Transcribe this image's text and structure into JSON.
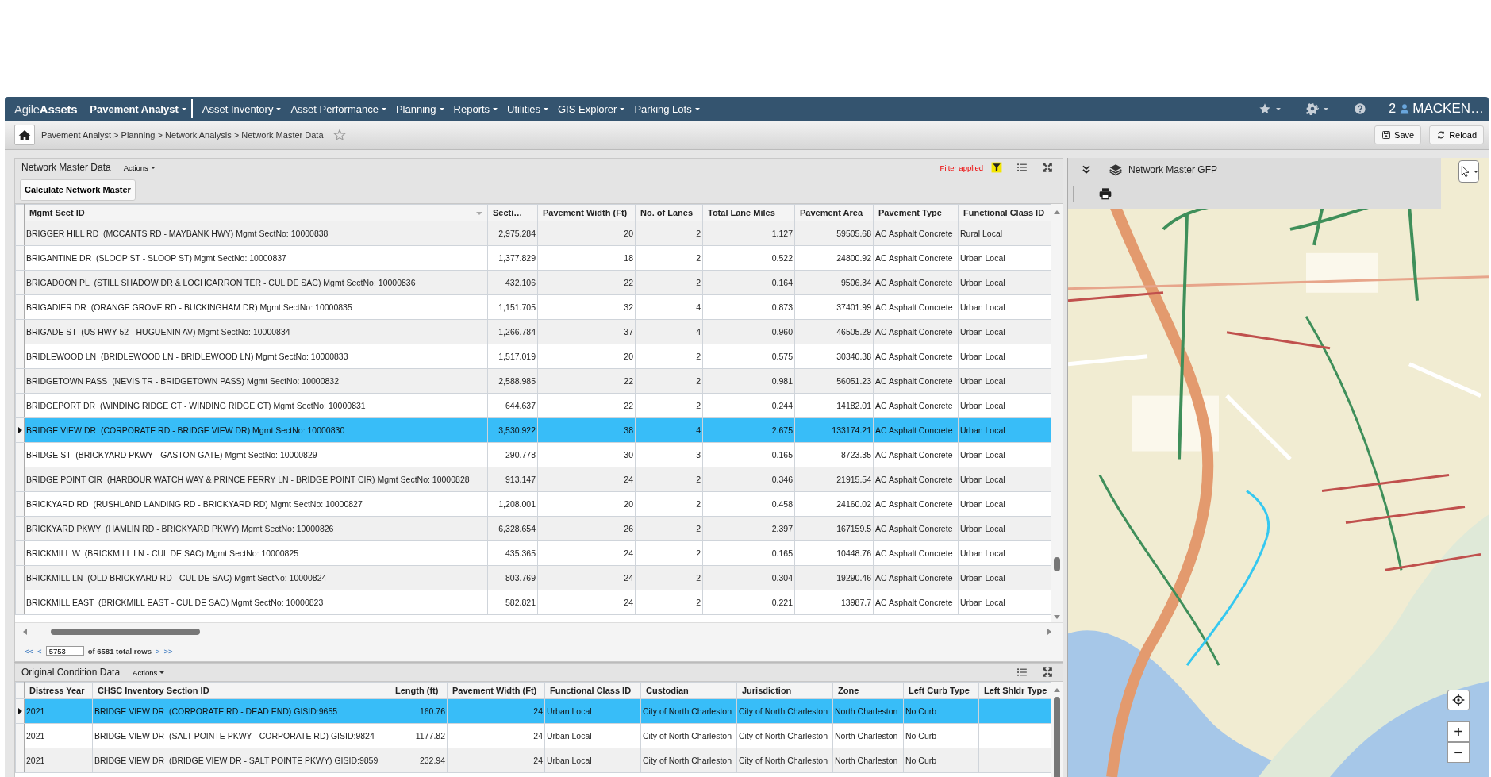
{
  "nav": {
    "logo": "Agile**Assets**",
    "menus": [
      {
        "label": "Pavement Analyst",
        "kind": "app"
      },
      {
        "label": "Asset Inventory",
        "kind": "menu"
      },
      {
        "label": "Asset Performance",
        "kind": "menu"
      },
      {
        "label": "Planning",
        "kind": "menu"
      },
      {
        "label": "Reports",
        "kind": "menu"
      },
      {
        "label": "Utilities",
        "kind": "menu"
      },
      {
        "label": "GIS Explorer",
        "kind": "menu"
      },
      {
        "label": "Parking Lots",
        "kind": "menu"
      }
    ],
    "notification_count": "2",
    "user": "MACKEN…"
  },
  "breadcrumb": {
    "path": "Pavement Analyst > Planning > Network Analysis > Network Master Data",
    "buttons": [
      "Save",
      "Reload"
    ]
  },
  "network_grid": {
    "title": "Network Master Data",
    "actions": "Actions",
    "filter_label": "Filter applied",
    "button": "Calculate Network Master",
    "columns": [
      {
        "label": "Mgmt Sect ID",
        "kind": "text"
      },
      {
        "label": "Secti…",
        "kind": "number"
      },
      {
        "label": "Pavement Width (Ft)",
        "kind": "number"
      },
      {
        "label": "No. of Lanes",
        "kind": "number"
      },
      {
        "label": "Total Lane Miles",
        "kind": "number"
      },
      {
        "label": "Pavement Area",
        "kind": "number"
      },
      {
        "label": "Pavement Type",
        "kind": "text"
      },
      {
        "label": "Functional Class ID",
        "kind": "text"
      }
    ],
    "rows": [
      {
        "selected": false,
        "cells": [
          "BRIGGER HILL RD  (MCCANTS RD - MAYBANK HWY) Mgmt SectNo: 10000838",
          "2,975.284",
          "20",
          "2",
          "1.127",
          "59505.68",
          "AC Asphalt Concrete",
          "Rural Local"
        ]
      },
      {
        "selected": false,
        "cells": [
          "BRIGANTINE DR  (SLOOP ST - SLOOP ST) Mgmt SectNo: 10000837",
          "1,377.829",
          "18",
          "2",
          "0.522",
          "24800.92",
          "AC Asphalt Concrete",
          "Urban Local"
        ]
      },
      {
        "selected": false,
        "cells": [
          "BRIGADOON PL  (STILL SHADOW DR & LOCHCARRON TER - CUL DE SAC) Mgmt SectNo: 10000836",
          "432.106",
          "22",
          "2",
          "0.164",
          "9506.34",
          "AC Asphalt Concrete",
          "Urban Local"
        ]
      },
      {
        "selected": false,
        "cells": [
          "BRIGADIER DR  (ORANGE GROVE RD - BUCKINGHAM DR) Mgmt SectNo: 10000835",
          "1,151.705",
          "32",
          "4",
          "0.873",
          "37401.99",
          "AC Asphalt Concrete",
          "Urban Local"
        ]
      },
      {
        "selected": false,
        "cells": [
          "BRIGADE ST  (US HWY 52 - HUGUENIN AV) Mgmt SectNo: 10000834",
          "1,266.784",
          "37",
          "4",
          "0.960",
          "46505.29",
          "AC Asphalt Concrete",
          "Urban Local"
        ]
      },
      {
        "selected": false,
        "cells": [
          "BRIDLEWOOD LN  (BRIDLEWOOD LN - BRIDLEWOOD LN) Mgmt SectNo: 10000833",
          "1,517.019",
          "20",
          "2",
          "0.575",
          "30340.38",
          "AC Asphalt Concrete",
          "Urban Local"
        ]
      },
      {
        "selected": false,
        "cells": [
          "BRIDGETOWN PASS  (NEVIS TR - BRIDGETOWN PASS) Mgmt SectNo: 10000832",
          "2,588.985",
          "22",
          "2",
          "0.981",
          "56051.23",
          "AC Asphalt Concrete",
          "Urban Local"
        ]
      },
      {
        "selected": false,
        "cells": [
          "BRIDGEPORT DR  (WINDING RIDGE CT - WINDING RIDGE CT) Mgmt SectNo: 10000831",
          "644.637",
          "22",
          "2",
          "0.244",
          "14182.01",
          "AC Asphalt Concrete",
          "Urban Local"
        ]
      },
      {
        "selected": true,
        "cells": [
          "BRIDGE VIEW DR  (CORPORATE RD - BRIDGE VIEW DR) Mgmt SectNo: 10000830",
          "3,530.922",
          "38",
          "4",
          "2.675",
          "133174.21",
          "AC Asphalt Concrete",
          "Urban Local"
        ]
      },
      {
        "selected": false,
        "cells": [
          "BRIDGE ST  (BRICKYARD PKWY - GASTON GATE) Mgmt SectNo: 10000829",
          "290.778",
          "30",
          "3",
          "0.165",
          "8723.35",
          "AC Asphalt Concrete",
          "Urban Local"
        ]
      },
      {
        "selected": false,
        "cells": [
          "BRIDGE POINT CIR  (HARBOUR WATCH WAY & PRINCE FERRY LN - BRIDGE POINT CIR) Mgmt SectNo: 10000828",
          "913.147",
          "24",
          "2",
          "0.346",
          "21915.54",
          "AC Asphalt Concrete",
          "Urban Local"
        ]
      },
      {
        "selected": false,
        "cells": [
          "BRICKYARD RD  (RUSHLAND LANDING RD - BRICKYARD RD) Mgmt SectNo: 10000827",
          "1,208.001",
          "20",
          "2",
          "0.458",
          "24160.02",
          "AC Asphalt Concrete",
          "Urban Local"
        ]
      },
      {
        "selected": false,
        "cells": [
          "BRICKYARD PKWY  (HAMLIN RD - BRICKYARD PKWY) Mgmt SectNo: 10000826",
          "6,328.654",
          "26",
          "2",
          "2.397",
          "167159.5",
          "AC Asphalt Concrete",
          "Urban Local"
        ]
      },
      {
        "selected": false,
        "cells": [
          "BRICKMILL W  (BRICKMILL LN - CUL DE SAC) Mgmt SectNo: 10000825",
          "435.365",
          "24",
          "2",
          "0.165",
          "10448.76",
          "AC Asphalt Concrete",
          "Urban Local"
        ]
      },
      {
        "selected": false,
        "cells": [
          "BRICKMILL LN  (OLD BRICKYARD RD - CUL DE SAC) Mgmt SectNo: 10000824",
          "803.769",
          "24",
          "2",
          "0.304",
          "19290.46",
          "AC Asphalt Concrete",
          "Urban Local"
        ]
      },
      {
        "selected": false,
        "cells": [
          "BRICKMILL EAST  (BRICKMILL EAST - CUL DE SAC) Mgmt SectNo: 10000823",
          "582.821",
          "24",
          "2",
          "0.221",
          "13987.7",
          "AC Asphalt Concrete",
          "Urban Local"
        ]
      }
    ],
    "pager": {
      "first": "<<",
      "prev": "<",
      "page": "5753",
      "total": "of 6581 total rows",
      "next": ">",
      "last": ">>"
    }
  },
  "condition_grid": {
    "title": "Original Condition Data",
    "actions": "Actions",
    "columns": [
      {
        "label": "Distress Year",
        "kind": "text"
      },
      {
        "label": "CHSC Inventory Section ID",
        "kind": "text"
      },
      {
        "label": "Length (ft)",
        "kind": "number"
      },
      {
        "label": "Pavement Width (Ft)",
        "kind": "number"
      },
      {
        "label": "Functional Class ID",
        "kind": "text"
      },
      {
        "label": "Custodian",
        "kind": "text"
      },
      {
        "label": "Jurisdiction",
        "kind": "text"
      },
      {
        "label": "Zone",
        "kind": "text"
      },
      {
        "label": "Left Curb Type",
        "kind": "text"
      },
      {
        "label": "Left Shldr Type",
        "kind": "text"
      }
    ],
    "rows": [
      {
        "selected": true,
        "cells": [
          "2021",
          "BRIDGE VIEW DR  (CORPORATE RD - DEAD END) GISID:9655",
          "160.76",
          "24",
          "Urban Local",
          "City of North Charleston",
          "City of North Charleston",
          "North Charleston",
          "No Curb",
          ""
        ]
      },
      {
        "selected": false,
        "cells": [
          "2021",
          "BRIDGE VIEW DR  (SALT POINTE PKWY - CORPORATE RD) GISID:9824",
          "1177.82",
          "24",
          "Urban Local",
          "City of North Charleston",
          "City of North Charleston",
          "North Charleston",
          "No Curb",
          ""
        ]
      },
      {
        "selected": false,
        "cells": [
          "2021",
          "BRIDGE VIEW DR  (BRIDGE VIEW DR - SALT POINTE PKWY) GISID:9859",
          "232.94",
          "24",
          "Urban Local",
          "City of North Charleston",
          "City of North Charleston",
          "North Charleston",
          "No Curb",
          ""
        ]
      }
    ]
  },
  "map": {
    "layer_title": "Network Master GFP",
    "zoom_in": "+",
    "zoom_out": "−"
  }
}
